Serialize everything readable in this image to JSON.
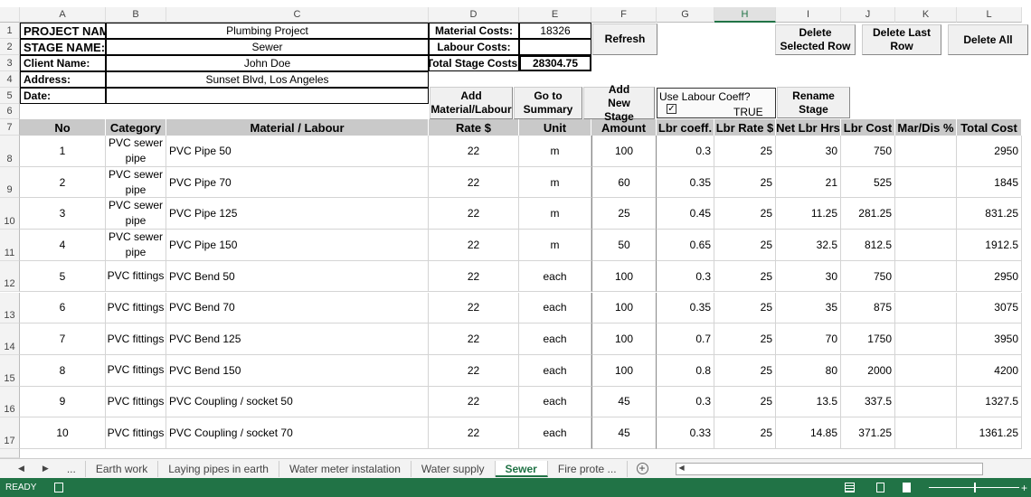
{
  "columns": [
    "A",
    "B",
    "C",
    "D",
    "E",
    "F",
    "G",
    "H",
    "I",
    "J",
    "K",
    "L"
  ],
  "info": {
    "project_label": "PROJECT NAME",
    "project": "Plumbing Project",
    "stage_label": "STAGE NAME:",
    "stage": "Sewer",
    "client_label": "Client Name:",
    "client": "John Doe",
    "address_label": "Address:",
    "address": "Sunset Blvd, Los Angeles",
    "date_label": "Date:",
    "date": ""
  },
  "costs": {
    "material_label": "Material Costs:",
    "material": "18326",
    "labour_label": "Labour Costs:",
    "labour": "",
    "total_label": "Total Stage Costs:",
    "total": "28304.75"
  },
  "buttons": {
    "refresh": "Refresh",
    "delete_selected": "Delete Selected Row",
    "delete_last": "Delete Last Row",
    "delete_all": "Delete All",
    "add_material": "Add Material/Labour",
    "go_summary": "Go to Summary",
    "add_stage": "Add New Stage",
    "rename_stage": "Rename Stage"
  },
  "labour_coeff": {
    "label": "Use Labour Coeff?",
    "checked": true,
    "value": "TRUE"
  },
  "headers": [
    "No",
    "Category",
    "Material / Labour",
    "Rate $",
    "Unit",
    "Amount",
    "Lbr coeff.",
    "Lbr Rate $",
    "Net Lbr Hrs",
    "Lbr Cost",
    "Mar/Dis %",
    "Total Cost"
  ],
  "rows": [
    [
      "1",
      "PVC sewer pipe",
      "PVC Pipe 50",
      "22",
      "m",
      "100",
      "0.3",
      "25",
      "30",
      "750",
      "",
      "2950"
    ],
    [
      "2",
      "PVC sewer pipe",
      "PVC Pipe 70",
      "22",
      "m",
      "60",
      "0.35",
      "25",
      "21",
      "525",
      "",
      "1845"
    ],
    [
      "3",
      "PVC sewer pipe",
      "PVC Pipe 125",
      "22",
      "m",
      "25",
      "0.45",
      "25",
      "11.25",
      "281.25",
      "",
      "831.25"
    ],
    [
      "4",
      "PVC sewer pipe",
      "PVC Pipe 150",
      "22",
      "m",
      "50",
      "0.65",
      "25",
      "32.5",
      "812.5",
      "",
      "1912.5"
    ],
    [
      "5",
      "PVC fittings",
      "PVC Bend 50",
      "22",
      "each",
      "100",
      "0.3",
      "25",
      "30",
      "750",
      "",
      "2950"
    ],
    [
      "6",
      "PVC fittings",
      "PVC Bend 70",
      "22",
      "each",
      "100",
      "0.35",
      "25",
      "35",
      "875",
      "",
      "3075"
    ],
    [
      "7",
      "PVC fittings",
      "PVC Bend 125",
      "22",
      "each",
      "100",
      "0.7",
      "25",
      "70",
      "1750",
      "",
      "3950"
    ],
    [
      "8",
      "PVC fittings",
      "PVC Bend 150",
      "22",
      "each",
      "100",
      "0.8",
      "25",
      "80",
      "2000",
      "",
      "4200"
    ],
    [
      "9",
      "PVC fittings",
      "PVC Coupling / socket 50",
      "22",
      "each",
      "45",
      "0.3",
      "25",
      "13.5",
      "337.5",
      "",
      "1327.5"
    ],
    [
      "10",
      "PVC fittings",
      "PVC Coupling / socket 70",
      "22",
      "each",
      "45",
      "0.33",
      "25",
      "14.85",
      "371.25",
      "",
      "1361.25"
    ]
  ],
  "sheet_tabs": [
    "Earth work",
    "Laying pipes in earth",
    "Water meter instalation",
    "Water supply",
    "Sewer",
    "Fire prote ..."
  ],
  "active_tab": "Sewer",
  "status": {
    "ready": "READY"
  },
  "accent": "#217346"
}
